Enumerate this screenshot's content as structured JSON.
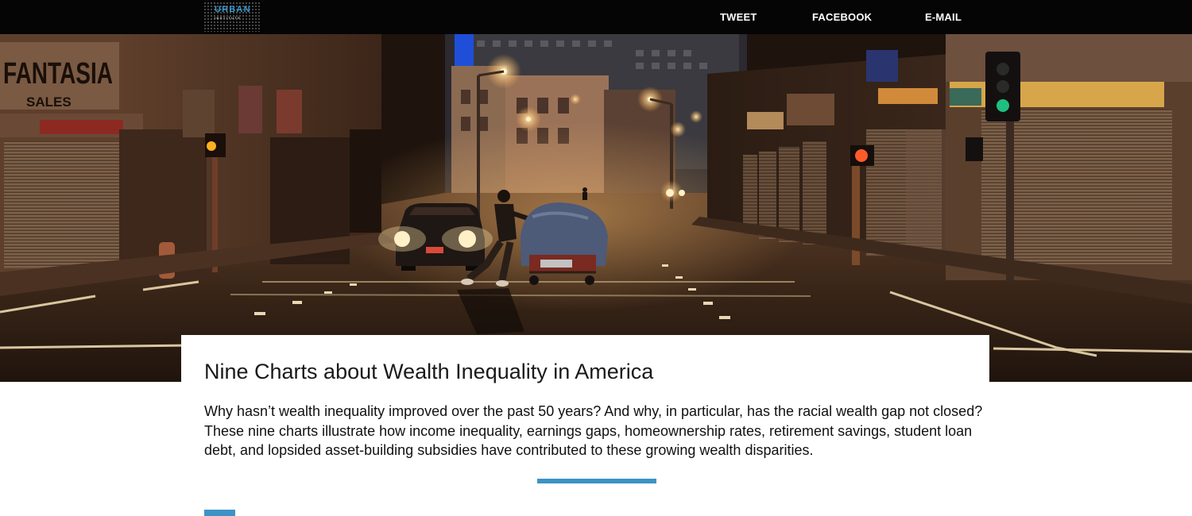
{
  "header": {
    "logo": {
      "name": "URBAN",
      "subtitle": "INSTITUTE"
    },
    "share": {
      "tweet": "TWEET",
      "facebook": "FACEBOOK",
      "email": "E-MAIL"
    }
  },
  "hero": {
    "image_alt": "Night street scene with a person pushing a covered cart across an intersection",
    "signs": {
      "fantasia": "FANTASIA",
      "sales": "SALES"
    }
  },
  "article": {
    "title": "Nine Charts about Wealth Inequality in America",
    "intro": "Why hasn’t wealth inequality improved over the past 50 years? And why, in particular, has the racial wealth gap not closed? These nine charts illustrate how income inequality, earnings gaps, homeownership rates, retirement savings, student loan debt, and lopsided asset-building subsidies have contributed to these growing wealth disparities."
  },
  "colors": {
    "accent": "#3d93c5",
    "topbar": "#050505",
    "logo": "#3a9bd2"
  }
}
